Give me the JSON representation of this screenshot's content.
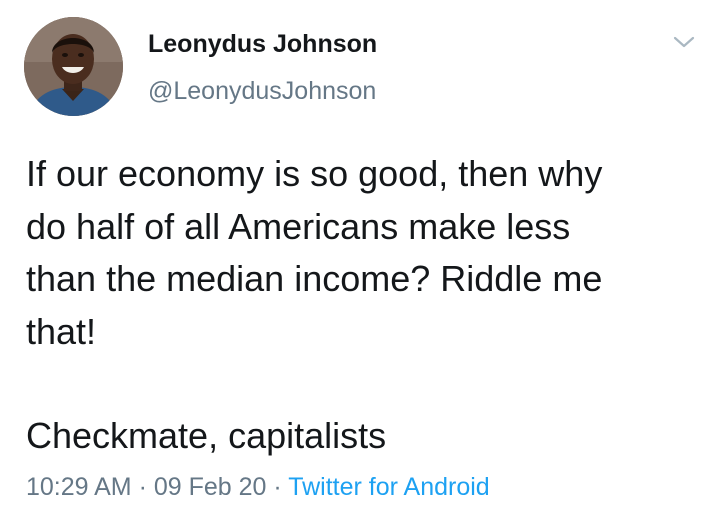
{
  "tweet": {
    "display_name": "Leonydus Johnson",
    "handle": "@LeonydusJohnson",
    "body_lines": [
      "If our economy is so good, then why",
      "do half of all Americans make less",
      "than the median income? Riddle me",
      "that!"
    ],
    "closing_line": "Checkmate, capitalists",
    "time": "10:29 AM",
    "separator": " · ",
    "date": "09 Feb 20",
    "source": "Twitter for Android"
  },
  "icons": {
    "avatar": "profile-photo",
    "caret": "chevron-down-icon"
  },
  "colors": {
    "text": "#14171a",
    "secondary": "#657786",
    "link": "#1da1f2",
    "caret": "#aab8c2"
  }
}
